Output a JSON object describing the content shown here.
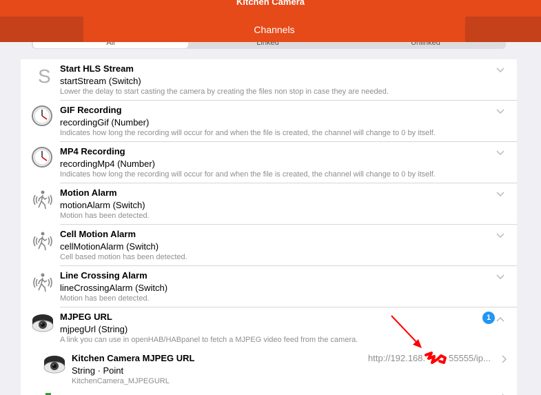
{
  "header": {
    "title": "Kitchen Camera"
  },
  "subheader": {
    "title": "Channels"
  },
  "segments": {
    "all": "All",
    "linked": "Linked",
    "unlinked": "Unlinked"
  },
  "channels": [
    {
      "label": "Start HLS Stream",
      "id": "startStream (Switch)",
      "desc": "Lower the delay to start casting the camera by creating the files non stop in case they are needed.",
      "icon": "s-letter-icon"
    },
    {
      "label": "GIF Recording",
      "id": "recordingGif (Number)",
      "desc": "Indicates how long the recording will occur for and when the file is created, the channel will change to 0 by itself.",
      "icon": "clock-icon"
    },
    {
      "label": "MP4 Recording",
      "id": "recordingMp4 (Number)",
      "desc": "Indicates how long the recording will occur for and when the file is created, the channel will change to 0 by itself.",
      "icon": "clock-icon"
    },
    {
      "label": "Motion Alarm",
      "id": "motionAlarm (Switch)",
      "desc": "Motion has been detected.",
      "icon": "motion-icon"
    },
    {
      "label": "Cell Motion Alarm",
      "id": "cellMotionAlarm (Switch)",
      "desc": "Cell based motion has been detected.",
      "icon": "motion-icon"
    },
    {
      "label": "Line Crossing Alarm",
      "id": "lineCrossingAlarm (Switch)",
      "desc": "Motion has been detected.",
      "icon": "motion-icon"
    },
    {
      "label": "MJPEG URL",
      "id": "mjpegUrl (String)",
      "desc": "A link you can use in openHAB/HABpanel to fetch a MJPEG video feed from the camera.",
      "icon": "camera-icon",
      "badge": "1"
    }
  ],
  "linked_item": {
    "label": "Kitchen Camera MJPEG URL",
    "type": "String · Point",
    "name": "KitchenCamera_MJPEGURL",
    "value": "http://192.168.",
    "value_tail": "55555/ip..."
  },
  "colors": {
    "accent": "#e64a19",
    "accent_dark": "#c4411a",
    "badge": "#2196f3",
    "annotation": "#ff0000"
  }
}
